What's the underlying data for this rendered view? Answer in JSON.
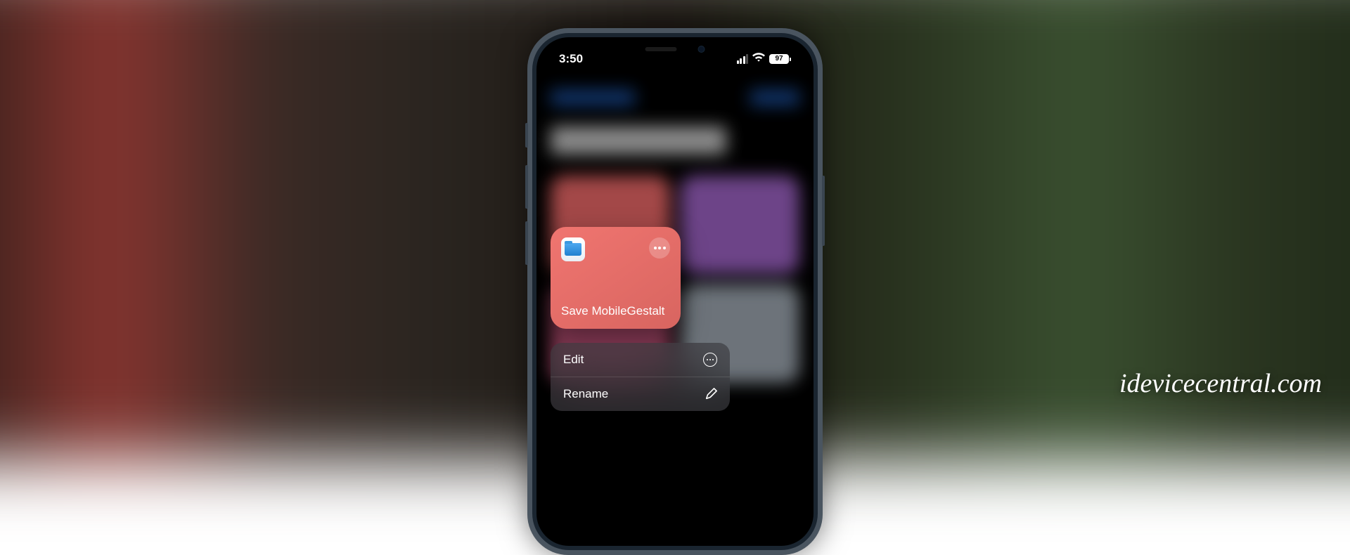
{
  "status_bar": {
    "time": "3:50",
    "battery_percent": "97"
  },
  "shortcut": {
    "name": "Save MobileGestalt",
    "icon": "files-folder"
  },
  "context_menu": {
    "items": [
      {
        "label": "Edit",
        "icon": "edit-circle"
      },
      {
        "label": "Rename",
        "icon": "pencil"
      }
    ]
  },
  "watermark": "idevicecentral.com"
}
